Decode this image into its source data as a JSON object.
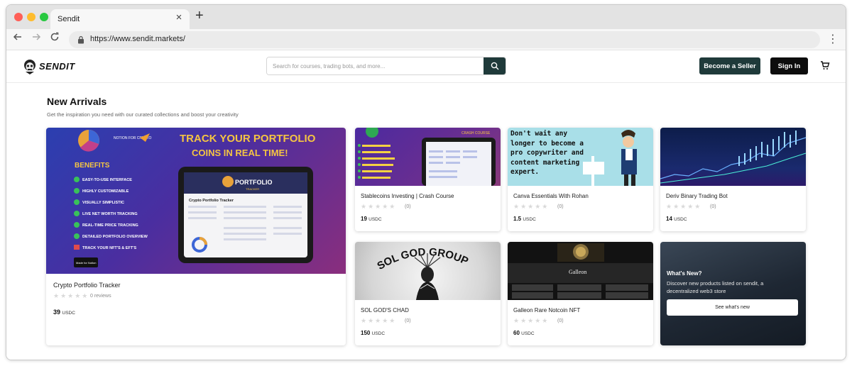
{
  "browser": {
    "tab_title": "Sendit",
    "tab_close": "×",
    "new_tab": "+",
    "url": "https://www.sendit.markets/"
  },
  "site": {
    "logo_text": "SENDIT",
    "search_placeholder": "Search for courses, trading bots, and more...",
    "become_seller": "Become a Seller",
    "sign_in": "Sign In"
  },
  "section": {
    "title": "New Arrivals",
    "subtitle": "Get the inspiration you need with our curated collections and boost your creativity"
  },
  "featured": {
    "title": "Crypto Portfolio Tracker",
    "reviews": "0 reviews",
    "price": "39",
    "currency": "USDC",
    "rating": 0,
    "image_text": {
      "headline_1": "TRACK YOUR PORTFOLIO",
      "headline_2": "COINS IN REAL TIME!",
      "badge": "NOTION FOR CRYPTO",
      "benefits": "BENEFITS",
      "features": [
        "EASY-TO-USE INTERFACE",
        "HIGHLY CUSTOMIZABLE",
        "VISUALLY SIMPLISTIC",
        "LIVE NET WORTH TRACKING",
        "REAL-TIME PRICE TRACKING",
        "DETAILED PORTFOLIO OVERVIEW",
        "TRACK YOUR NFT'S & EFT'S"
      ],
      "made_for": "Made for Notion",
      "screen_title": "PORTFOLIO",
      "screen_sub": "TRACKER",
      "screen_heading": "Crypto Portfolio Tracker"
    }
  },
  "products": [
    {
      "title": "Stablecoins Investing | Crash Course",
      "reviews": "(0)",
      "price": "19",
      "currency": "USDC",
      "rating": 0,
      "image_text": "CRASH COURSE"
    },
    {
      "title": "Canva Essentials With Rohan",
      "reviews": "(0)",
      "price": "1.5",
      "currency": "USDC",
      "rating": 0,
      "image_text": "Don't wait any longer to become a pro copywriter and content marketing expert."
    },
    {
      "title": "Deriv Binary Trading Bot",
      "reviews": "(0)",
      "price": "14",
      "currency": "USDC",
      "rating": 0
    },
    {
      "title": "SOL GOD'S CHAD",
      "reviews": "(0)",
      "price": "150",
      "currency": "USDC",
      "rating": 0,
      "image_text": "SOL GOD GROUP"
    },
    {
      "title": "Galleon Rare Notcoin NFT",
      "reviews": "(0)",
      "price": "60",
      "currency": "USDC",
      "rating": 0,
      "image_text": "Galleon"
    }
  ],
  "whats_new": {
    "title": "What's New?",
    "text": "Discover new products listed on sendit, a decentralized web3 store",
    "button": "See what's new"
  },
  "colors": {
    "accent": "#1f3a3a",
    "dark": "#0d0d0d",
    "star_empty": "#d9d9d9"
  }
}
